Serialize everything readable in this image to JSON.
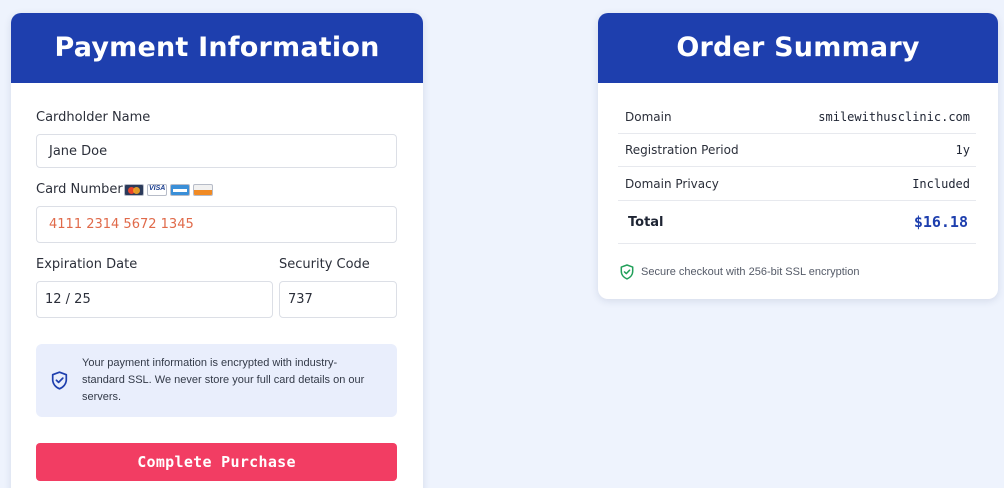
{
  "payment": {
    "title": "Payment Information",
    "cardholder": {
      "label": "Cardholder Name",
      "value": "Jane Doe"
    },
    "card_number": {
      "label": "Card Number",
      "value": "4111 2314 5672 1345",
      "value_color": "#e06a4a",
      "card_icons": [
        "mastercard-icon",
        "visa-icon",
        "amex-icon",
        "discover-icon"
      ]
    },
    "expiration": {
      "label": "Expiration Date",
      "value": "12 / 25"
    },
    "security_code": {
      "label": "Security Code",
      "value": "737"
    },
    "notice": {
      "icon": "shield-icon",
      "text": "Your payment information is encrypted with industry-standard SSL. We never store your full card details on our servers."
    },
    "submit_label": "Complete Purchase"
  },
  "summary": {
    "title": "Order Summary",
    "rows": [
      {
        "label": "Domain",
        "value": "smilewithusclinic.com"
      },
      {
        "label": "Registration Period",
        "value": "1y"
      },
      {
        "label": "Domain Privacy",
        "value": "Included"
      }
    ],
    "total": {
      "label": "Total",
      "value": "$16.18"
    },
    "secure_text": "Secure checkout with 256-bit SSL encryption",
    "secure_icon": "shield-check-icon"
  },
  "colors": {
    "header_bg": "#1e3fae",
    "accent_button": "#f23d63",
    "page_bg": "#eef3fd",
    "secure_green": "#22a05a"
  }
}
